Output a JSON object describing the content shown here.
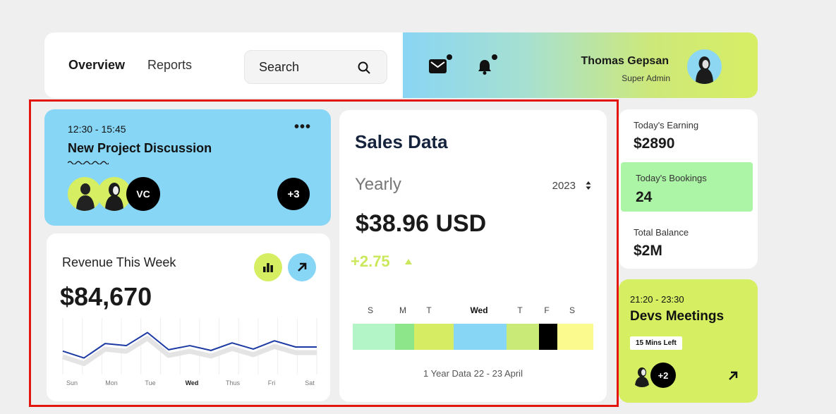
{
  "nav": {
    "overview": "Overview",
    "reports": "Reports",
    "search_label": "Search"
  },
  "user": {
    "name": "Thomas Gepsan",
    "role": "Super Admin"
  },
  "meeting": {
    "time": "12:30 - 15:45",
    "title": "New Project Discussion",
    "initials": "VC",
    "extra": "+3"
  },
  "revenue": {
    "title": "Revenue This Week",
    "value": "$84,670",
    "days": [
      "Sun",
      "Mon",
      "Tue",
      "Wed",
      "Thus",
      "Fri",
      "Sat"
    ],
    "active_day": "Wed"
  },
  "chart_data": {
    "type": "line",
    "title": "Revenue This Week",
    "categories": [
      "Sun",
      "Mon",
      "Tue",
      "Wed",
      "Thus",
      "Fri",
      "Sat"
    ],
    "series": [
      {
        "values": [
          34,
          24,
          45,
          42,
          61,
          36,
          42,
          35,
          46,
          37,
          49,
          40,
          40
        ]
      }
    ],
    "ylim": [
      0,
      80
    ],
    "grid": true
  },
  "sales": {
    "title": "Sales Data",
    "period": "Yearly",
    "year": "2023",
    "value": "$38.96 USD",
    "change": "+2.75",
    "week_letters": [
      "S",
      "M",
      "T",
      "Wed",
      "T",
      "F",
      "S"
    ],
    "footer": "1 Year Data 22 - 23 April",
    "bar_colors": [
      "#b4f5c8",
      "#8ee68a",
      "#d6ed63",
      "#88d6f6",
      "#c9ea76",
      "#000000",
      "#fbfa8e"
    ]
  },
  "stats": {
    "earning_label": "Today's Earning",
    "earning_value": "$2890",
    "booking_label": "Today's Bookings",
    "booking_value": "24",
    "balance_label": "Total Balance",
    "balance_value": "$2M"
  },
  "devs": {
    "time": "21:20 - 23:30",
    "title": "Devs Meetings",
    "badge": "15 Mins Left",
    "extra": "+2"
  },
  "colors": {
    "accent_blue": "#88d6f6",
    "accent_lime": "#d5ee62",
    "accent_green": "#adf5a6",
    "line": "#1c3aa3",
    "highlight_border": "#e3150f"
  },
  "icons": [
    "search-icon",
    "mail-icon",
    "bell-icon",
    "more-icon",
    "bar-chart-icon",
    "arrow-up-right-icon",
    "sort-icon"
  ]
}
